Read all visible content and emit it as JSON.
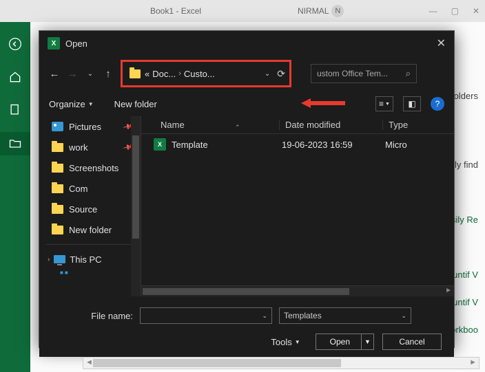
{
  "titlebar": {
    "book": "Book1 - Excel",
    "user": "NIRMAL",
    "avatar": "N"
  },
  "sidebar_bs": {
    "items": [
      "back",
      "home",
      "new",
      "open"
    ]
  },
  "right_snips": {
    "folders": "olders",
    "find": "sily find",
    "re": "asily Re",
    "cv1": "ountif V",
    "cv2": "ountif V",
    "wb": "Vorkboo"
  },
  "dialog": {
    "title": "Open",
    "breadcrumb": {
      "prefix": "«",
      "seg1": "Doc...",
      "seg2": "Custo..."
    },
    "search": {
      "placeholder": "ustom Office Tem..."
    },
    "toolbar": {
      "organize": "Organize",
      "newfolder": "New folder"
    },
    "tree": {
      "items": [
        {
          "icon": "pic",
          "label": "Pictures",
          "pin": true
        },
        {
          "icon": "folder",
          "label": "work",
          "pin": true
        },
        {
          "icon": "folder",
          "label": "Screenshots"
        },
        {
          "icon": "folder",
          "label": "Com"
        },
        {
          "icon": "folder",
          "label": "Source"
        },
        {
          "icon": "folder",
          "label": "New folder"
        }
      ],
      "thispc": "This PC"
    },
    "columns": {
      "name": "Name",
      "date": "Date modified",
      "type": "Type"
    },
    "files": [
      {
        "name": "Template",
        "date": "19-06-2023 16:59",
        "type": "Micro"
      }
    ],
    "footer": {
      "filename_label": "File name:",
      "filename_value": "",
      "filter": "Templates",
      "tools": "Tools",
      "open": "Open",
      "cancel": "Cancel"
    }
  }
}
